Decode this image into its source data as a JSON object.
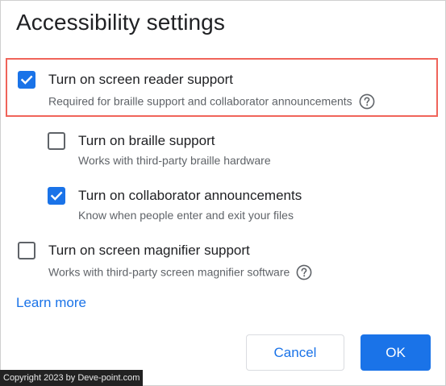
{
  "dialog": {
    "title": "Accessibility settings"
  },
  "options": [
    {
      "label": "Turn on screen reader support",
      "description": "Required for braille support and collaborator announcements",
      "checked": true,
      "help_icon": "question-circle-icon"
    },
    {
      "label": "Turn on braille support",
      "description": "Works with third-party braille hardware",
      "checked": false
    },
    {
      "label": "Turn on collaborator announcements",
      "description": "Know when people enter and exit your files",
      "checked": true
    },
    {
      "label": "Turn on screen magnifier support",
      "description": "Works with third-party screen magnifier software",
      "checked": false,
      "help_icon": "question-circle-icon"
    }
  ],
  "links": {
    "learn_more": "Learn more"
  },
  "buttons": {
    "cancel": "Cancel",
    "ok": "OK"
  },
  "watermark": "Copyright 2023 by Deve-point.com",
  "colors": {
    "accent": "#1a73e8",
    "highlight_border": "#f0645a",
    "text_primary": "#202124",
    "text_secondary": "#5f6368"
  }
}
